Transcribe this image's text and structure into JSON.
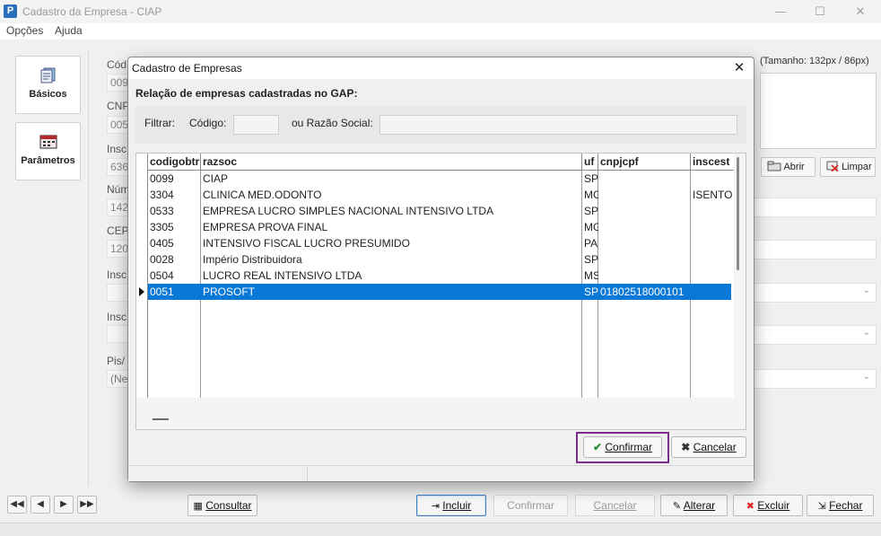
{
  "window": {
    "title": "Cadastro da Empresa - CIAP",
    "app_icon_letter": "P",
    "minimize": "—",
    "maximize": "☐",
    "close": "✕"
  },
  "menu": [
    "Opções",
    "Ajuda"
  ],
  "side_tabs": [
    {
      "label": "Básicos",
      "icon": "document-stack-icon"
    },
    {
      "label": "Parâmetros",
      "icon": "calendar-icon"
    }
  ],
  "background_form": {
    "labels": [
      "Cód",
      "CNP",
      "Insc",
      "Núm",
      "CEP",
      "Insc",
      "Insc",
      "Pis/"
    ],
    "values": [
      "009",
      "005",
      "636",
      "142",
      "120",
      "(Ne"
    ]
  },
  "logo": {
    "hint": "(Tamanho: 132px / 86px)",
    "open_label": "Abrir",
    "clear_label": "Limpar"
  },
  "nav_buttons": [
    "◀◀",
    "◀",
    "▶",
    "▶▶"
  ],
  "actions": {
    "consultar": "Consultar",
    "incluir": "Incluir",
    "confirmar": "Confirmar",
    "cancelar": "Cancelar",
    "alterar": "Alterar",
    "excluir": "Excluir",
    "fechar": "Fechar"
  },
  "dialog": {
    "title": "Cadastro de Empresas",
    "close": "✕",
    "heading": "Relação de empresas cadastradas no GAP:",
    "filter_label": "Filtrar:",
    "code_label": "Código:",
    "name_label": "ou Razão Social:",
    "code_value": "",
    "name_value": "",
    "columns": [
      "codigobtr",
      "razsoc",
      "uf",
      "cnpjcpf",
      "inscest"
    ],
    "rows": [
      {
        "codigo": "0099",
        "razsoc": "CIAP",
        "uf": "SP",
        "cnpjcpf": "",
        "inscest": ""
      },
      {
        "codigo": "3304",
        "razsoc": "CLINICA MED.ODONTO",
        "uf": "MG",
        "cnpjcpf": "",
        "inscest": "ISENTO"
      },
      {
        "codigo": "0533",
        "razsoc": "EMPRESA LUCRO SIMPLES NACIONAL INTENSIVO LTDA",
        "uf": "SP",
        "cnpjcpf": "",
        "inscest": ""
      },
      {
        "codigo": "3305",
        "razsoc": "EMPRESA PROVA FINAL",
        "uf": "MG",
        "cnpjcpf": "",
        "inscest": ""
      },
      {
        "codigo": "0405",
        "razsoc": "INTENSIVO FISCAL LUCRO PRESUMIDO",
        "uf": "PA",
        "cnpjcpf": "",
        "inscest": ""
      },
      {
        "codigo": "0028",
        "razsoc": "Império Distribuidora",
        "uf": "SP",
        "cnpjcpf": "",
        "inscest": ""
      },
      {
        "codigo": "0504",
        "razsoc": "LUCRO REAL INTENSIVO LTDA",
        "uf": "MS",
        "cnpjcpf": "",
        "inscest": ""
      },
      {
        "codigo": "0051",
        "razsoc": "PROSOFT",
        "uf": "SP",
        "cnpjcpf": "01802518000101",
        "inscest": ""
      }
    ],
    "selected_row": 7,
    "confirm_label": "Confirmar",
    "cancel_label": "Cancelar",
    "selection_color": "#0a78d7",
    "highlight_color": "#7b2d8e"
  }
}
